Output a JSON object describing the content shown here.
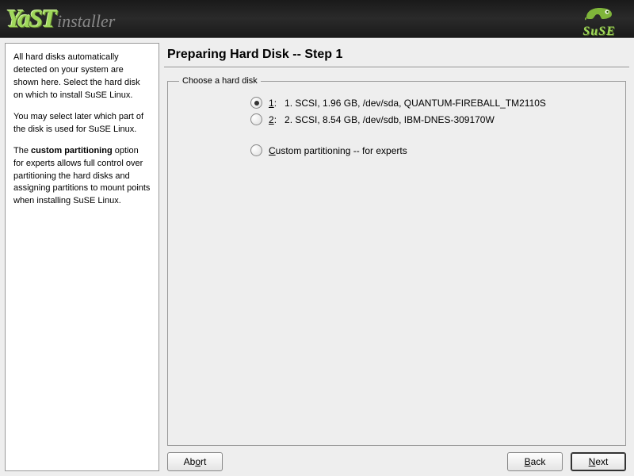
{
  "header": {
    "logo_main": "YaST",
    "logo_sub": "installer",
    "brand": "SuSE"
  },
  "sidebar": {
    "para1": "All hard disks automatically detected on your system are shown here. Select the hard disk on which to install SuSE Linux.",
    "para2": "You may select later which part of the disk is used for SuSE Linux.",
    "para3_pre": "The ",
    "para3_bold": "custom partitioning",
    "para3_post": " option for experts allows full control over partitioning the hard disks and assigning partitions to mount points when installing SuSE Linux."
  },
  "main": {
    "title": "Preparing Hard Disk -- Step 1",
    "group_legend": "Choose a hard disk",
    "options": [
      {
        "key": "1",
        "acc": "1",
        "suffix": ":",
        "desc": "1. SCSI, 1.96 GB, /dev/sda, QUANTUM-FIREBALL_TM2110S",
        "selected": true
      },
      {
        "key": "2",
        "acc": "2",
        "suffix": ":",
        "desc": "2. SCSI, 8.54 GB, /dev/sdb, IBM-DNES-309170W",
        "selected": false
      }
    ],
    "custom_option": {
      "acc": "C",
      "rest": "ustom partitioning -- for experts",
      "selected": false
    }
  },
  "buttons": {
    "abort": {
      "acc": "",
      "pre": "Ab",
      "u": "o",
      "post": "rt"
    },
    "back": {
      "acc": "",
      "pre": "",
      "u": "B",
      "post": "ack"
    },
    "next": {
      "acc": "",
      "pre": "",
      "u": "N",
      "post": "ext"
    }
  }
}
